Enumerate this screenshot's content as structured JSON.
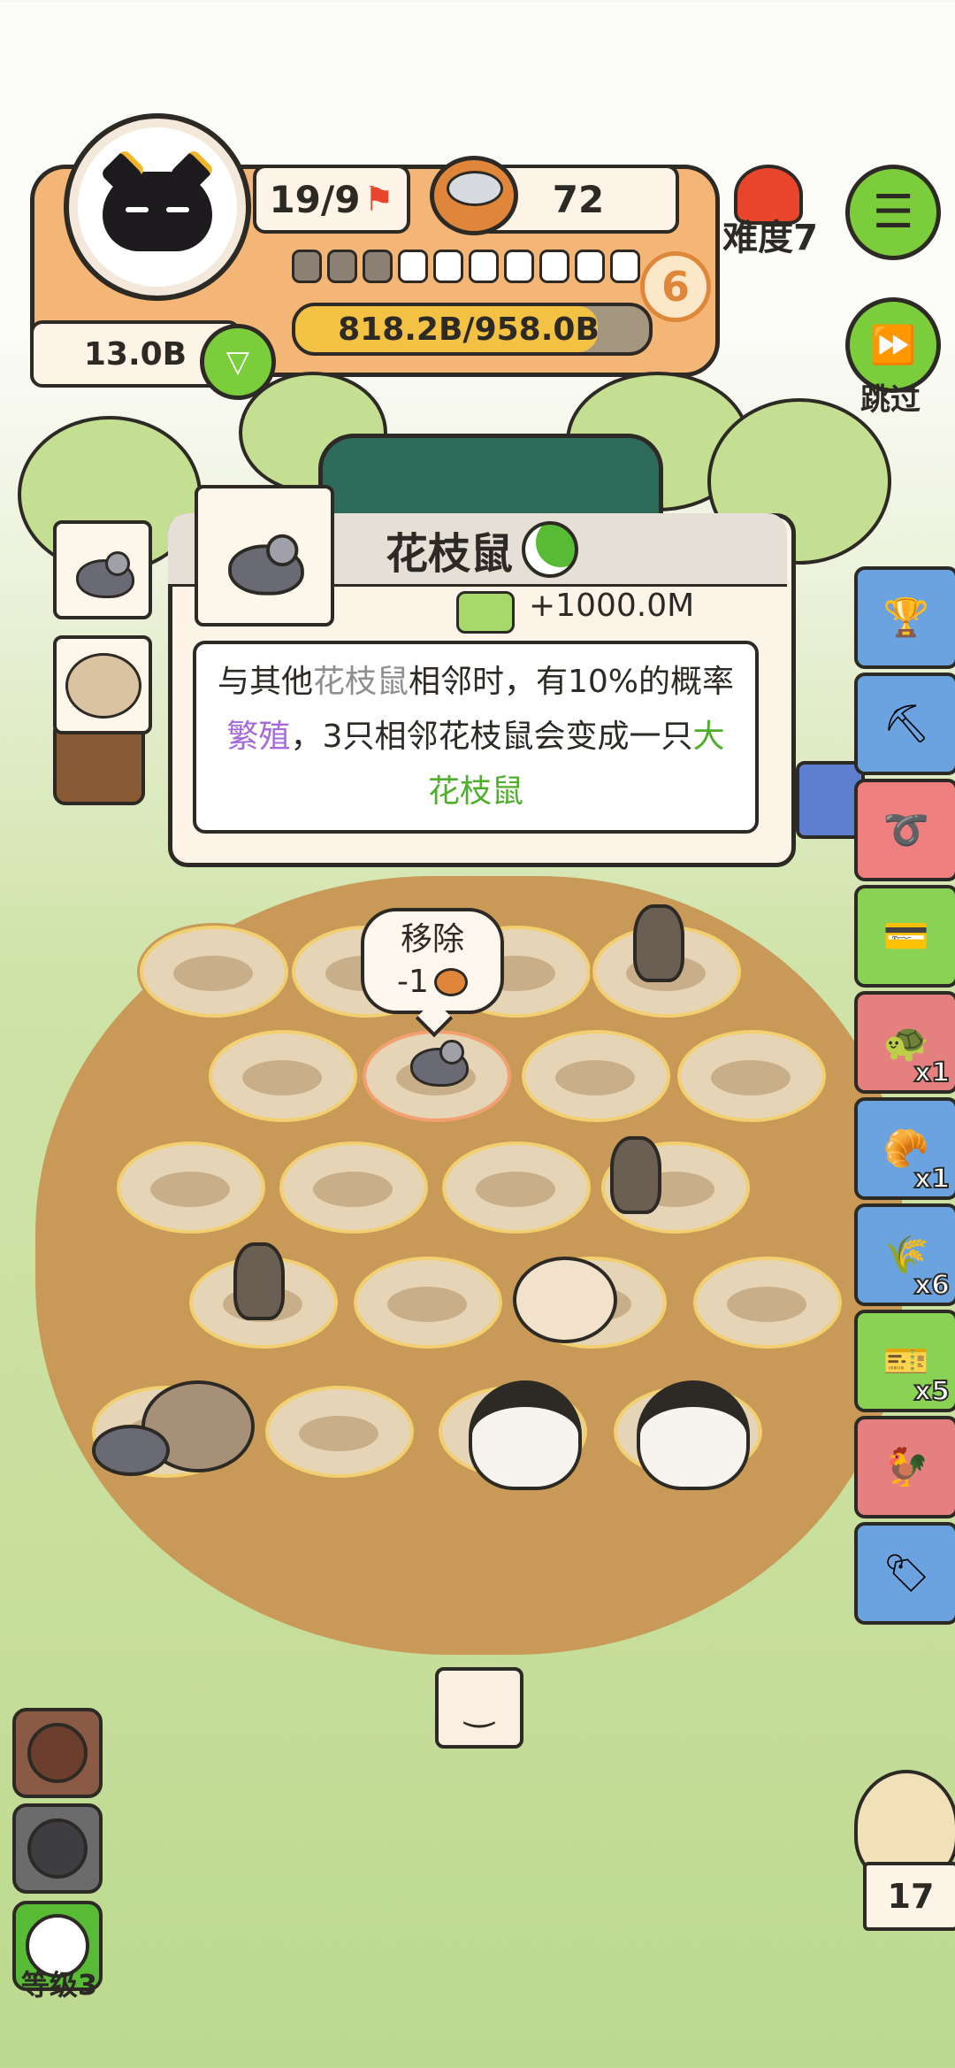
{
  "hud": {
    "kills": "19/9",
    "cans": "72",
    "money": "13.0B",
    "progress_text": "818.2B/958.0B",
    "progress_fraction": 0.854,
    "level_badge": "6",
    "segments_filled": 3,
    "segments_total": 10,
    "difficulty": "难度7",
    "skip_label": "跳过"
  },
  "popup": {
    "title": "花枝鼠",
    "income": "+1000.0M",
    "desc_part1": "与其他",
    "desc_kw1": "花枝鼠",
    "desc_part2": "相邻时，有10%的概率",
    "desc_kw2": "繁殖",
    "desc_part3": "，3只相邻花枝鼠会变成一只",
    "desc_kw3": "大花枝鼠"
  },
  "remove_bubble": {
    "label": "移除",
    "cost": "-1"
  },
  "side_items": [
    {
      "name": "trophy-icon",
      "glyph": "🏆",
      "count": ""
    },
    {
      "name": "pot-icon",
      "glyph": "⛏",
      "count": ""
    },
    {
      "name": "rope-icon",
      "glyph": "➰",
      "count": ""
    },
    {
      "name": "card-icon",
      "glyph": "💳",
      "count": ""
    },
    {
      "name": "turtle-shell-icon",
      "glyph": "🐢",
      "count": "x1"
    },
    {
      "name": "bread-icon",
      "glyph": "🥐",
      "count": "x1"
    },
    {
      "name": "seed-sack-icon",
      "glyph": "🌾",
      "count": "x6"
    },
    {
      "name": "refresh-ticket-icon",
      "glyph": "🎫",
      "count": "x5"
    },
    {
      "name": "chicken-icon",
      "glyph": "🐓",
      "count": ""
    },
    {
      "name": "discount-ticket-icon",
      "glyph": "🏷",
      "count": ""
    }
  ],
  "bottom": {
    "level_label": "等级3",
    "owl_count": "17"
  },
  "colors": {
    "accent_green": "#7ccd3c",
    "hud_orange": "#f4b677",
    "dirt": "#c99a57",
    "keyword_purple": "#a569db",
    "keyword_green": "#4fae2b"
  }
}
